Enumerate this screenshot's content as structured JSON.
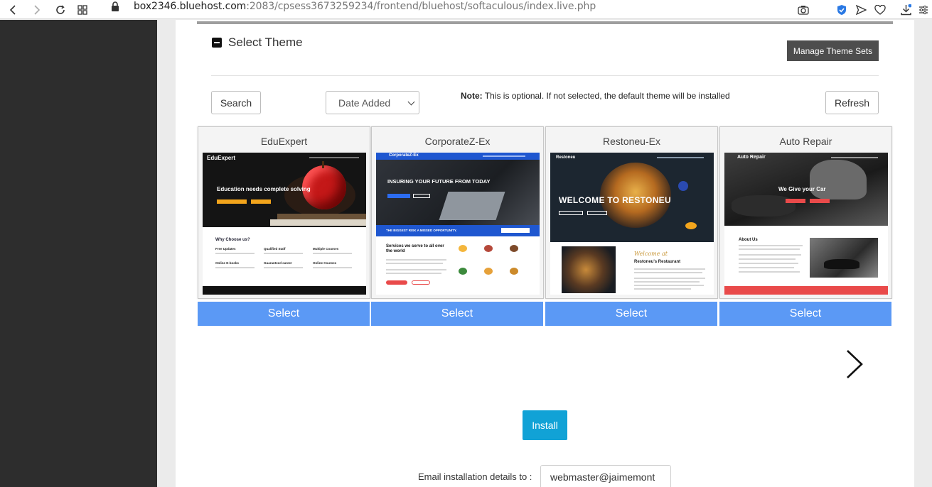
{
  "browser": {
    "url_host": "box2346.bluehost.com",
    "url_rest": ":2083/cpsess3673259234/frontend/bluehost/softaculous/index.live.php"
  },
  "section": {
    "title": "Select Theme",
    "manage_label": "Manage Theme Sets"
  },
  "toolbar": {
    "search_label": "Search",
    "sort_value": "Date Added",
    "note_label": "Note:",
    "note_text": "This is optional. If not selected, the default theme will be installed",
    "refresh_label": "Refresh"
  },
  "themes": [
    {
      "name": "EduExpert",
      "select_label": "Select",
      "preview": {
        "brand": "EduExpert",
        "hero": "Education needs complete solving",
        "section_heading": "Why Choose us?",
        "features": [
          "Free Updates",
          "Qualified Staff",
          "Multiple Courses",
          "Online E-books",
          "Guaranteed career",
          "Online Courses"
        ]
      }
    },
    {
      "name": "CorporateZ-Ex",
      "select_label": "Select",
      "preview": {
        "brand": "CorporateZ-Ex",
        "hero": "INSURING YOUR FUTURE FROM TODAY",
        "banner": "THE BIGGEST RISK A MISSED OPPORTUNITY.",
        "section_heading": "Services we serve to all over the world"
      }
    },
    {
      "name": "Restoneu-Ex",
      "select_label": "Select",
      "preview": {
        "brand": "Restoneu",
        "hero": "WELCOME TO RESTONEU",
        "script_heading": "Welcome at",
        "section_heading": "Restoneu's Restaurant"
      }
    },
    {
      "name": "Auto Repair",
      "select_label": "Select",
      "preview": {
        "brand": "Auto Repair",
        "hero": "We Give your Car",
        "section_heading": "About Us"
      }
    }
  ],
  "install_label": "Install",
  "email": {
    "label": "Email installation details to :",
    "value": "webmaster@jaimemont"
  },
  "colors": {
    "select_blue": "#5b99f5",
    "install_blue": "#11a2d6",
    "sidebar": "#2d2d2d",
    "manage_button": "#4d4d4d"
  }
}
